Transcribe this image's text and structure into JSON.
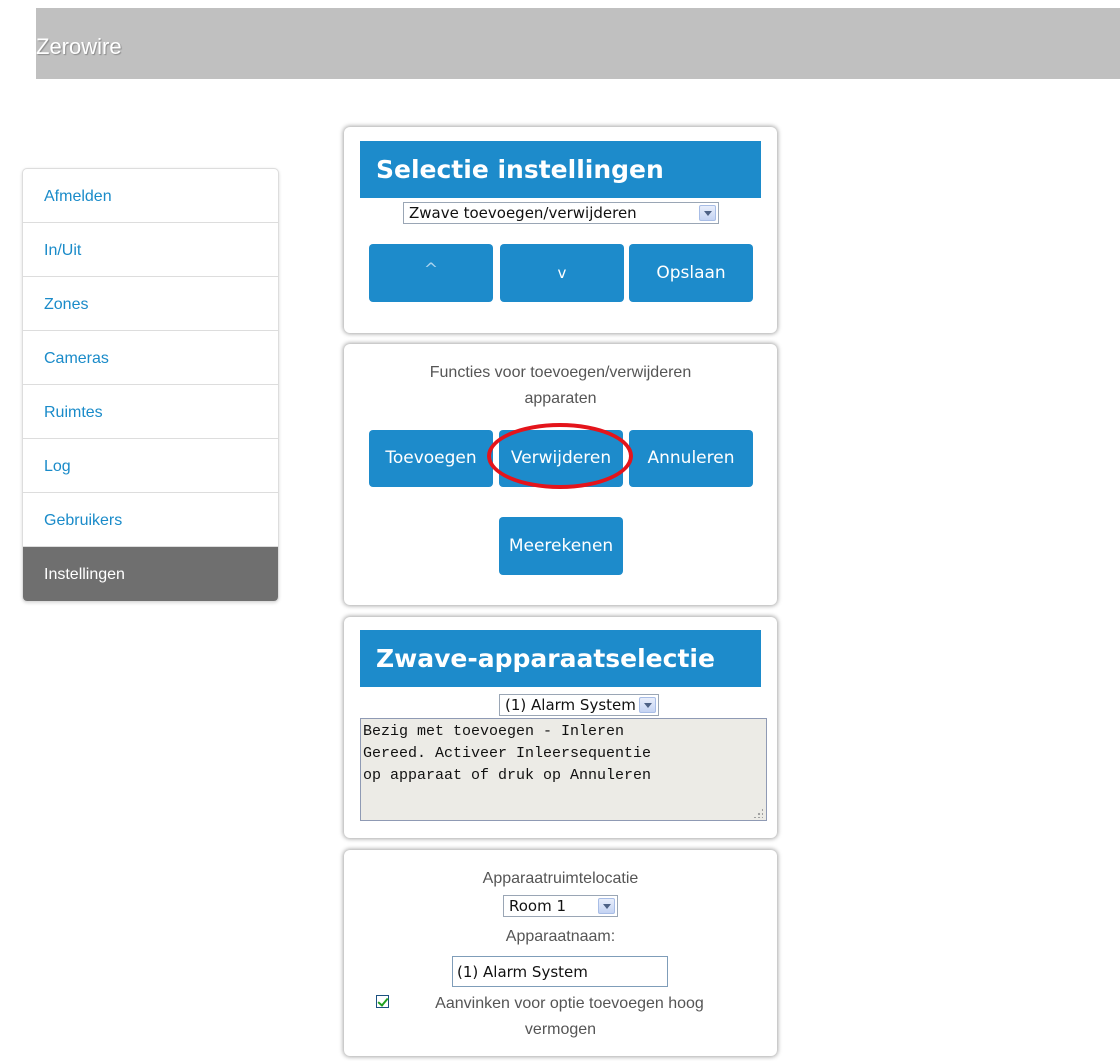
{
  "header": {
    "title": "Zerowire"
  },
  "sidebar": {
    "items": [
      {
        "label": "Afmelden"
      },
      {
        "label": "In/Uit"
      },
      {
        "label": "Zones"
      },
      {
        "label": "Cameras"
      },
      {
        "label": "Ruimtes"
      },
      {
        "label": "Log"
      },
      {
        "label": "Gebruikers"
      },
      {
        "label": "Instellingen",
        "active": true
      }
    ]
  },
  "settings_panel": {
    "heading": "Selectie instellingen",
    "select_value": "Zwave toevoegen/verwijderen",
    "up_label": "^",
    "down_label": "v",
    "save_label": "Opslaan"
  },
  "functions_panel": {
    "description_line1": "Functies voor toevoegen/verwijderen",
    "description_line2": "apparaten",
    "add_label": "Toevoegen",
    "remove_label": "Verwijderen",
    "cancel_label": "Annuleren",
    "count_label": "Meerekenen"
  },
  "device_panel": {
    "heading": "Zwave-apparaatselectie",
    "device_select_value": "(1) Alarm System",
    "status_text": "Bezig met toevoegen - Inleren\nGereed. Activeer Inleersequentie\nop apparaat of druk op Annuleren"
  },
  "location_panel": {
    "room_label": "Apparaatruimtelocatie",
    "room_value": "Room 1",
    "name_label": "Apparaatnaam:",
    "name_value": "(1) Alarm System",
    "checkbox_label_line1": "Aanvinken voor optie toevoegen hoog",
    "checkbox_label_line2": "vermogen",
    "checkbox_checked": true
  },
  "colors": {
    "accent": "#1d8bcb",
    "header_bg": "#c0c0c0",
    "active_nav": "#6f6f6f",
    "highlight": "#e4141b"
  }
}
